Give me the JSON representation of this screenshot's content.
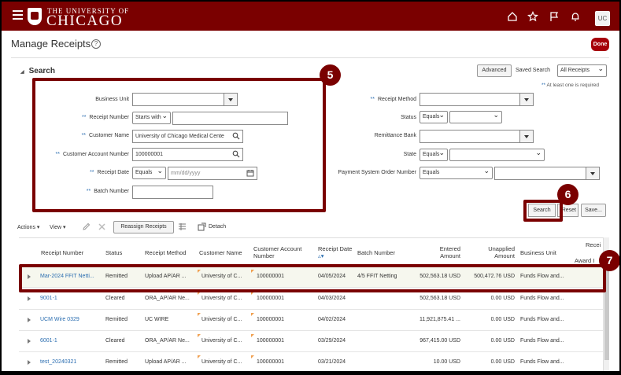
{
  "header": {
    "logo_small": "THE UNIVERSITY OF",
    "logo_big": "CHICAGO",
    "avatar": "UC"
  },
  "page": {
    "title": "Manage Receipts",
    "done_label": "Done"
  },
  "search": {
    "heading": "Search",
    "advanced_label": "Advanced",
    "saved_search_label": "Saved Search",
    "saved_search_value": "All Receipts",
    "required_note_stars": "**",
    "required_note_text": "At least one is required",
    "fields": {
      "business_unit_label": "Business Unit",
      "receipt_number_label": "Receipt Number",
      "receipt_number_op": "Starts with",
      "customer_name_label": "Customer Name",
      "customer_name_value": "University of Chicago Medical Cente",
      "customer_account_label": "Customer Account Number",
      "customer_account_value": "100000001",
      "receipt_date_label": "Receipt Date",
      "receipt_date_op": "Equals",
      "receipt_date_placeholder": "mm/dd/yyyy",
      "batch_number_label": "Batch Number",
      "receipt_method_label": "Receipt Method",
      "status_label": "Status",
      "status_op": "Equals",
      "remittance_bank_label": "Remittance Bank",
      "state_label": "State",
      "state_op": "Equals",
      "payment_system_label": "Payment System Order Number",
      "payment_system_op": "Equals"
    },
    "search_button": "Search",
    "reset_button": "Reset",
    "save_button": "Save..."
  },
  "steps": {
    "five": "5",
    "six": "6",
    "seven": "7"
  },
  "toolbar": {
    "actions": "Actions",
    "view": "View",
    "reassign": "Reassign Receipts",
    "detach": "Detach"
  },
  "table": {
    "headers": {
      "receipt_number": "Receipt Number",
      "status": "Status",
      "receipt_method": "Receipt Method",
      "customer_name": "Customer Name",
      "customer_account": "Customer Account Number",
      "receipt_date": "Receipt Date",
      "batch_number": "Batch Number",
      "entered_amount": "Entered Amount",
      "unapplied_amount": "Unapplied Amount",
      "business_unit": "Business Unit",
      "receipt_award_1": "Recei",
      "receipt_award_2": "Award I"
    },
    "rows": [
      {
        "receipt_number": "Mar-2024 FFIT Netti...",
        "status": "Remitted",
        "method": "Upload AP/AR ...",
        "customer": "University of C...",
        "account": "100000001",
        "date": "04/05/2024",
        "batch": "4/5 FFIT Netting",
        "entered": "502,563.18 USD",
        "unapplied": "500,472.76 USD",
        "bu": "Funds Flow and..."
      },
      {
        "receipt_number": "9001-1",
        "status": "Cleared",
        "method": "ORA_AP/AR Ne...",
        "customer": "University of C...",
        "account": "100000001",
        "date": "04/03/2024",
        "batch": "",
        "entered": "502,563.18 USD",
        "unapplied": "0.00 USD",
        "bu": "Funds Flow and..."
      },
      {
        "receipt_number": "UCM Wire 0329",
        "status": "Remitted",
        "method": "UC WIRE",
        "customer": "University of C...",
        "account": "100000001",
        "date": "04/02/2024",
        "batch": "",
        "entered": "11,921,875.41 ...",
        "unapplied": "0.00 USD",
        "bu": "Funds Flow and..."
      },
      {
        "receipt_number": "6001-1",
        "status": "Cleared",
        "method": "ORA_AP/AR Ne...",
        "customer": "University of C...",
        "account": "100000001",
        "date": "03/29/2024",
        "batch": "",
        "entered": "967,415.00 USD",
        "unapplied": "0.00 USD",
        "bu": "Funds Flow and..."
      },
      {
        "receipt_number": "test_20240321",
        "status": "Remitted",
        "method": "Upload AP/AR ...",
        "customer": "University of C...",
        "account": "100000001",
        "date": "03/21/2024",
        "batch": "",
        "entered": "10.00 USD",
        "unapplied": "0.00 USD",
        "bu": "Funds Flow and..."
      }
    ]
  }
}
